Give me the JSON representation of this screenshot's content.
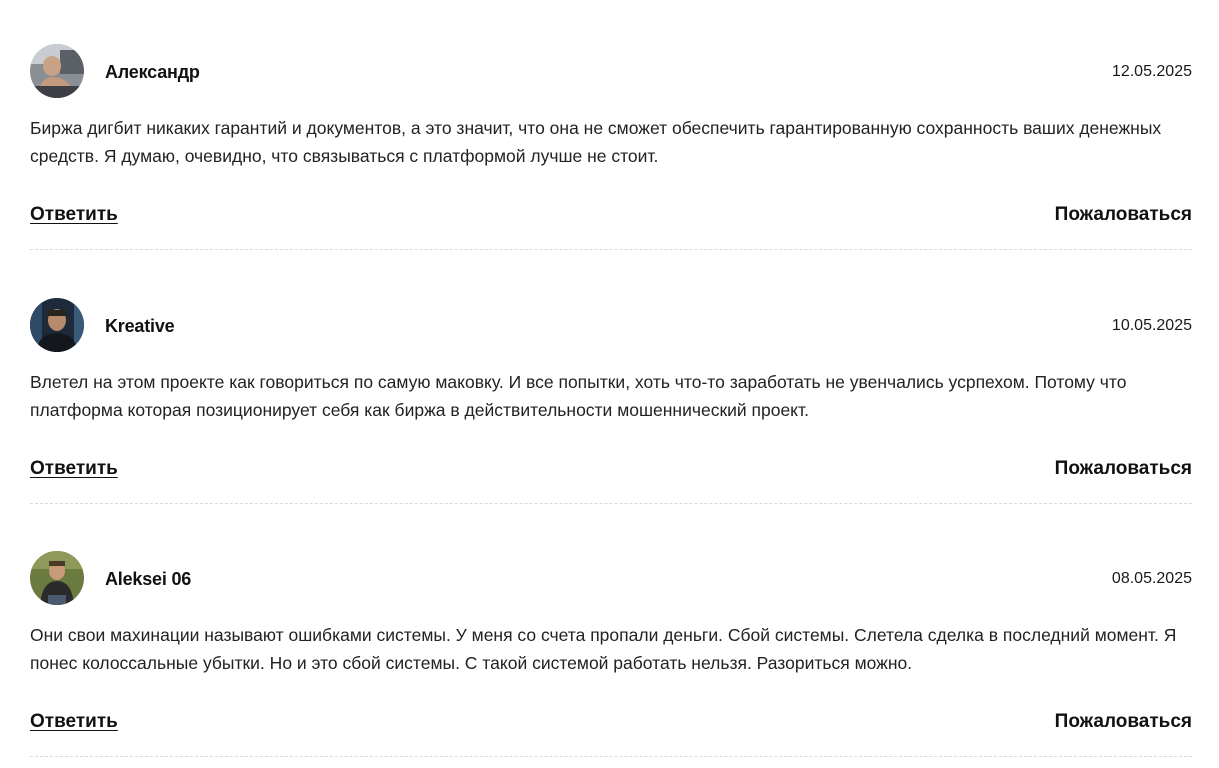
{
  "comments": [
    {
      "author": "Александр",
      "date": "12.05.2025",
      "text": "Биржа дигбит никаких гарантий и документов, а это значит, что она не сможет обеспечить гарантированную сохранность ваших денежных средств. Я думаю, очевидно, что связываться с платформой лучше не стоит.",
      "reply_label": "Ответить",
      "report_label": "Пожаловаться"
    },
    {
      "author": "Kreative",
      "date": "10.05.2025",
      "text": "Влетел на этом проекте как говориться по самую маковку. И все попытки, хоть что-то заработать не увенчались усрпехом. Потому что платформа которая позиционирует себя как биржа в действительности мошеннический проект.",
      "reply_label": "Ответить",
      "report_label": "Пожаловаться"
    },
    {
      "author": "Aleksei 06",
      "date": "08.05.2025",
      "text": "Они свои махинации называют ошибками системы. У меня со счета пропали деньги. Сбой системы. Слетела сделка в последний момент. Я понес колоссальные убытки. Но и это сбой системы. С такой системой работать нельзя. Разориться можно.",
      "reply_label": "Ответить",
      "report_label": "Пожаловаться"
    }
  ]
}
